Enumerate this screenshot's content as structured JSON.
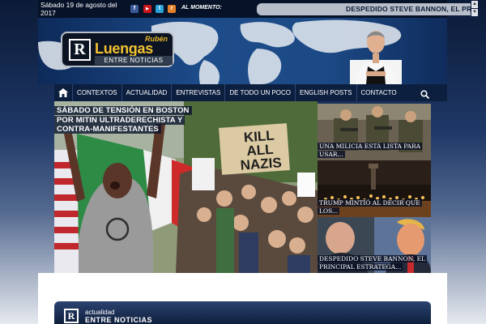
{
  "topbar": {
    "date": "Sábado 19 de agosto del 2017",
    "social": [
      {
        "icon": "facebook-icon",
        "glyph": "f",
        "color": "#3b5998"
      },
      {
        "icon": "youtube-icon",
        "glyph": "▶",
        "color": "#cc181e"
      },
      {
        "icon": "twitter-icon",
        "glyph": "t",
        "color": "#2aa3d8"
      },
      {
        "icon": "rss-icon",
        "glyph": "r",
        "color": "#e6822b"
      }
    ],
    "alm_label": "AL MOMENTO:",
    "ticker": "DESPEDIDO STEVE BANNON, EL PRI"
  },
  "header": {
    "logo_top": "Rubén",
    "logo_name": "Luengas",
    "logo_sub": "ENTRE NOTICIAS",
    "logo_mark": "R"
  },
  "nav": {
    "items": [
      "CONTEXTOS",
      "ACTUALIDAD",
      "ENTREVISTAS",
      "DE TODO UN POCO",
      "ENGLISH POSTS",
      "CONTACTO"
    ]
  },
  "main_story": {
    "title": "SÁBADO DE TENSIÓN EN BOSTON POR MITIN ULTRADERECHISTA Y CONTRA-MANIFESTANTES",
    "sign_line1": "KILL",
    "sign_line2": "ALL",
    "sign_line3": "NAZIS"
  },
  "side_stories": [
    {
      "caption": "UNA MILICIA ESTÁ LISTA PARA USAR..."
    },
    {
      "caption": "TRUMP MINTIÓ AL DECIR QUE LOS..."
    },
    {
      "caption": "DESPEDIDO STEVE BANNON, EL PRINCIPAL ESTRATEGA..."
    }
  ],
  "section": {
    "line1": "actualidad",
    "line2": "ENTRE NOTICIAS",
    "mark": "R"
  }
}
